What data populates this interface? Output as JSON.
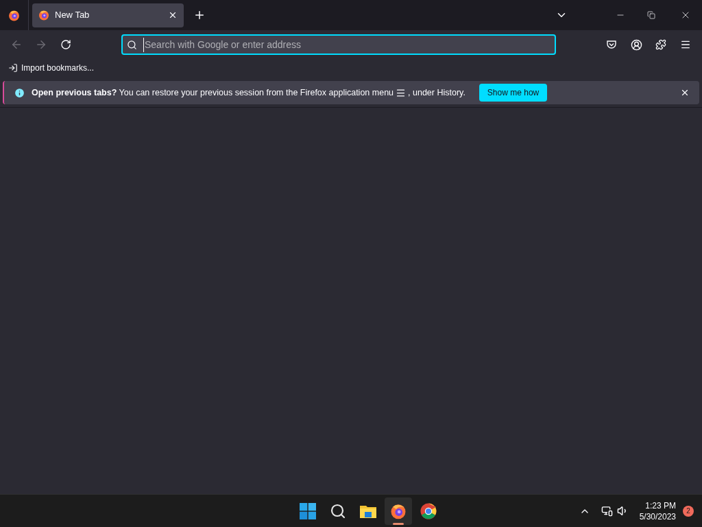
{
  "tabs": [
    {
      "title": "New Tab",
      "selected": true
    }
  ],
  "address_bar": {
    "placeholder": "Search with Google or enter address"
  },
  "bookmarks_toolbar": {
    "items": [
      "Import bookmarks..."
    ]
  },
  "notification": {
    "message": "**Open previous tabs?** You can restore your previous session from the Firefox application menu",
    "message_end": ", under History.",
    "button": "Show me how"
  },
  "taskbar": {
    "apps": [
      {
        "kind": "start",
        "selected": false
      },
      {
        "kind": "search",
        "selected": false
      },
      {
        "kind": "files",
        "selected": false
      },
      {
        "kind": "firefox",
        "selected": true
      },
      {
        "kind": "chrome",
        "selected": false
      }
    ],
    "time": "1:23 PM",
    "date": "5/30/2023",
    "notification_count": "2"
  }
}
